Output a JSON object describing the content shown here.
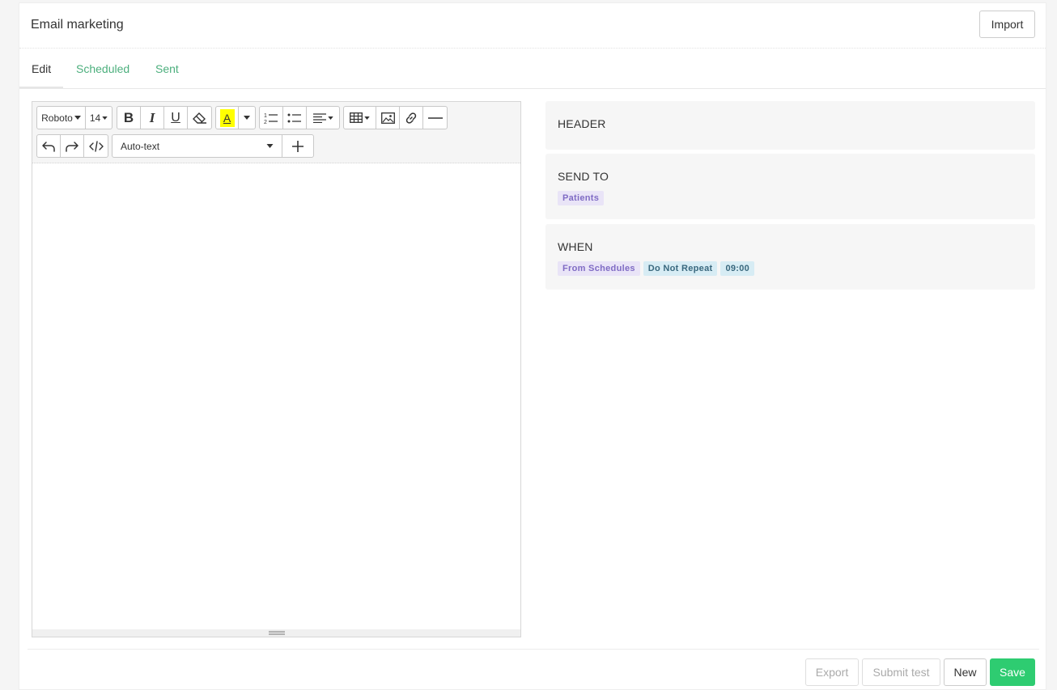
{
  "header": {
    "title": "Email marketing",
    "import_label": "Import"
  },
  "tabs": [
    {
      "label": "Edit",
      "active": true
    },
    {
      "label": "Scheduled",
      "active": false
    },
    {
      "label": "Sent",
      "active": false
    }
  ],
  "toolbar": {
    "font_family": "Roboto",
    "font_size": "14",
    "autotext_value": "Auto-text",
    "icons": [
      "bold-icon",
      "italic-icon",
      "underline-icon",
      "eraser-icon",
      "text-highlight-icon",
      "ordered-list-icon",
      "unordered-list-icon",
      "align-icon",
      "table-icon",
      "image-icon",
      "link-icon",
      "horizontal-rule-icon",
      "undo-icon",
      "redo-icon",
      "code-view-icon",
      "plus-icon"
    ],
    "bold": "B",
    "italic": "I",
    "underline": "U",
    "highlight": "A",
    "highlight_color": "#ffff00"
  },
  "cards": {
    "header": {
      "title": "HEADER"
    },
    "send_to": {
      "title": "SEND TO",
      "badges": [
        "Patients"
      ]
    },
    "when": {
      "title": "WHEN",
      "badges": [
        "From Schedules",
        "Do Not Repeat",
        "09:00"
      ]
    }
  },
  "footer": {
    "export_label": "Export",
    "submit_test_label": "Submit test",
    "new_label": "New",
    "save_label": "Save"
  },
  "colors": {
    "accent": "#2ecc71",
    "tab_link": "#4caf7d",
    "badge_purple": "#7f6bc4",
    "badge_teal": "#39687e"
  }
}
